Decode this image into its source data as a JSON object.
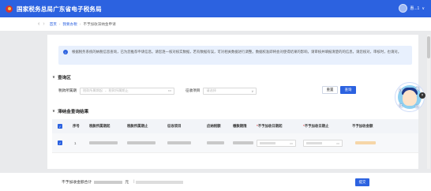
{
  "header": {
    "site_title": "国家税务总局广东省电子税务局",
    "user_name": "惠...1",
    "user_caret": "∨"
  },
  "breadcrumb": {
    "back_icon": "‹",
    "forward_icon": "›",
    "items": [
      "首页",
      "我要办税",
      "不予加收滞纳金申请"
    ],
    "separator": "›"
  },
  "notice": {
    "icon": "i",
    "text": "根据税务系统的纳税信息查询，已为您推荐申请信息。请您逐一核对核实数据，若有数据有误，可对相关数据进行调整。数据校准即将会对使得结果的影响，请审核并填报清楚的的信息，请您核对，审核时，也请对。"
  },
  "query_section": {
    "title": "查询区",
    "chevron": "∨",
    "period_label": "税款所属期",
    "period_start_placeholder": "税款所属期起",
    "period_end_placeholder": "税款所属期止",
    "period_separator": "-",
    "calendar_icon": "▭",
    "item_label": "征收项目",
    "item_placeholder": "请选择",
    "dropdown_icon": "∨",
    "reset_label": "重置",
    "query_label": "查询"
  },
  "results_section": {
    "title": "滞纳金查询结果",
    "chevron": "∨",
    "columns": {
      "index": "序号",
      "period_start": "税款所属期起",
      "period_end": "税款所属期止",
      "tax_item": "征收项目",
      "approval_code": "应纳税额",
      "tax_amount": "缴款期限",
      "waive_start": "不予加收日期起",
      "waive_end": "不予加收日期止",
      "waive_amount": "不予加收金额"
    },
    "required_mark": "*",
    "check_mark": "✓",
    "rows": [
      {
        "index": "1"
      }
    ]
  },
  "footer": {
    "total_label": "不予加收金额合计",
    "total_unit": "元",
    "total_extra": "|",
    "submit_label": "提交"
  },
  "assistant": {
    "chars": [
      "办",
      "税",
      "征",
      "动"
    ],
    "close_icon": "×"
  }
}
